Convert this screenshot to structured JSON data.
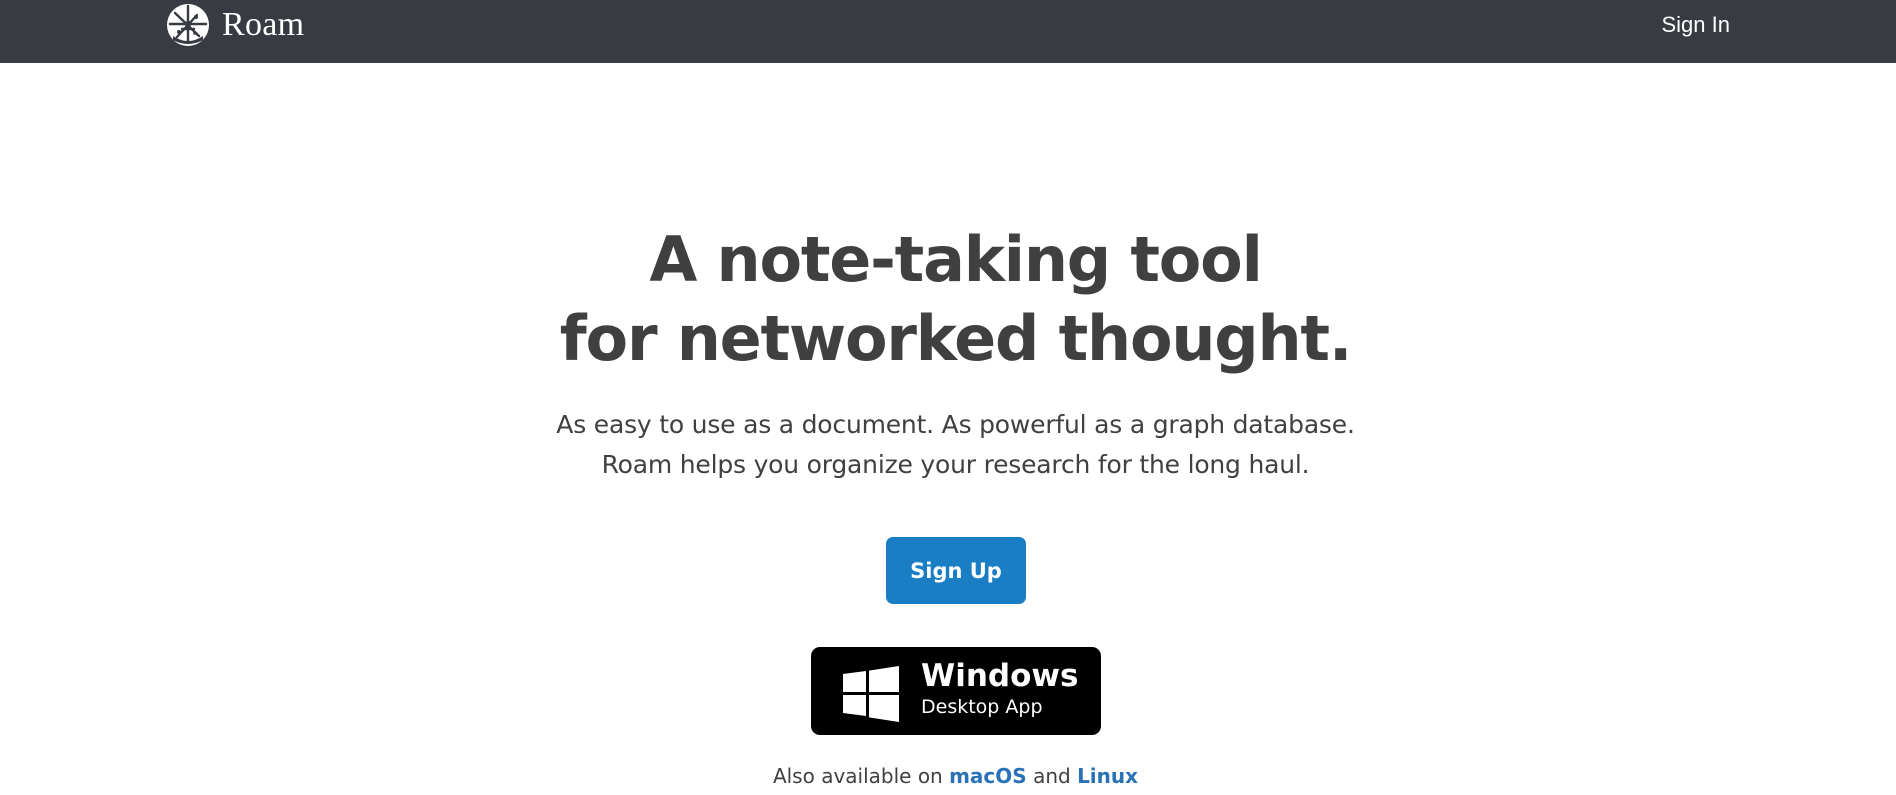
{
  "colors": {
    "navbar_bg": "#383b42",
    "text_dark": "#404040",
    "accent_blue": "#1a7ec4",
    "link_blue": "#2a72b5",
    "windows_button_bg": "#000000"
  },
  "navbar": {
    "brand_name": "Roam",
    "logo_icon": "roam-logo-icon",
    "signin_label": "Sign In"
  },
  "hero": {
    "headline_line1": "A note-taking tool",
    "headline_line2": "for networked thought.",
    "subhead_line1": "As easy to use as a document. As powerful as a graph database.",
    "subhead_line2": "Roam helps you organize your research for the long haul."
  },
  "signup": {
    "label": "Sign Up"
  },
  "windows_download": {
    "icon": "windows-logo-icon",
    "title": "Windows",
    "subtitle": "Desktop App"
  },
  "platforms": {
    "prefix": "Also available on",
    "macos": "macOS",
    "conjunction": "and",
    "linux": "Linux"
  }
}
